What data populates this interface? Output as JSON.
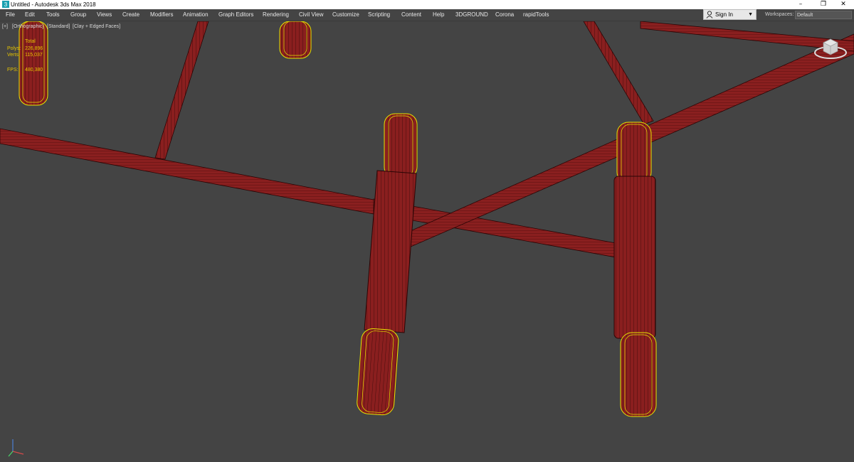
{
  "window": {
    "title": "Untitled - Autodesk 3ds Max 2018",
    "controls": {
      "minimize": "–",
      "restore": "❐",
      "close": "✕"
    }
  },
  "menu": {
    "items": [
      {
        "label": "File"
      },
      {
        "label": "Edit"
      },
      {
        "label": "Tools"
      },
      {
        "label": "Group"
      },
      {
        "label": "Views"
      },
      {
        "label": "Create"
      },
      {
        "label": "Modifiers"
      },
      {
        "label": "Animation"
      },
      {
        "label": "Graph Editors"
      },
      {
        "label": "Rendering"
      },
      {
        "label": "Civil View"
      },
      {
        "label": "Customize"
      },
      {
        "label": "Scripting"
      },
      {
        "label": "Content"
      },
      {
        "label": "Help"
      },
      {
        "label": "3DGROUND"
      },
      {
        "label": "Corona"
      },
      {
        "label": "rapidTools"
      }
    ],
    "signin_label": "Sign In",
    "workspaces_label": "Workspaces:",
    "workspaces_value": "Default"
  },
  "viewport": {
    "label_plus": "[+]",
    "label_view": "[Orthographic]",
    "label_shading_std": "[Standard]",
    "label_shading": "[Clay + Edged Faces]",
    "stats": {
      "header": "Total",
      "polys_label": "Polys:",
      "polys_value": "226,896",
      "verts_label": "Verts:",
      "verts_value": "115,037",
      "fps_label": "FPS:",
      "fps_value": "480,380"
    }
  },
  "colors": {
    "background": "#444444",
    "pipe": "#8a1f1f",
    "wire": "#2a0505",
    "selection": "#e6e600",
    "stats_text": "#e6c400"
  }
}
